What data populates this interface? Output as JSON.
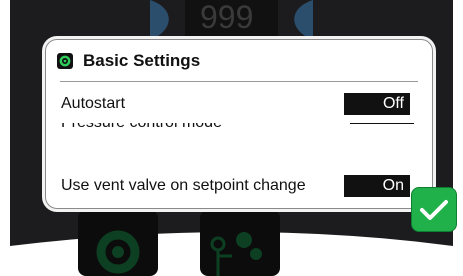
{
  "background": {
    "counter_display": "999"
  },
  "dialog": {
    "icon": "gear-icon",
    "title": "Basic Settings",
    "rows": [
      {
        "label": "Autostart",
        "value": "Off"
      },
      {
        "label": "Pressure control mode",
        "value": ""
      },
      {
        "label": "Use vent valve on setpoint change",
        "value": "On"
      }
    ]
  },
  "ok_button": {
    "icon": "checkmark-icon"
  },
  "colors": {
    "accent_green": "#20b14a",
    "panel_dark": "#1c1c1e",
    "toggle_bg": "#111111"
  }
}
